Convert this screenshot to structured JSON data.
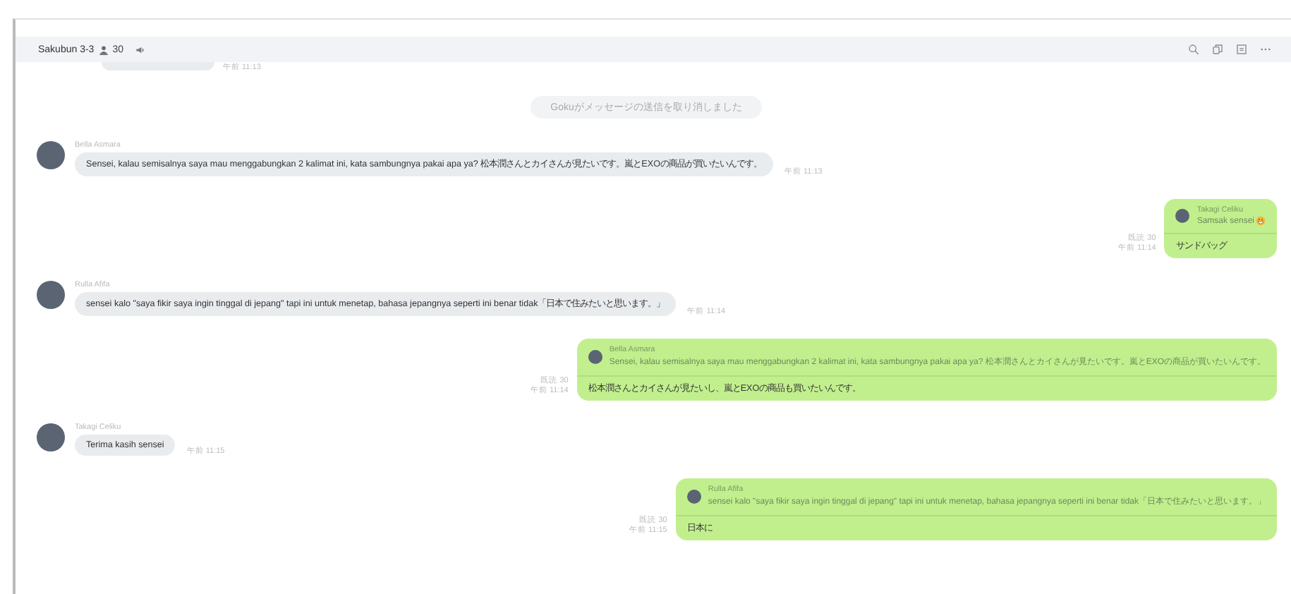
{
  "header": {
    "title": "Sakubun 3-3",
    "member_count": "30"
  },
  "messages": [
    {
      "kind": "cut",
      "time": "午前 11:13"
    },
    {
      "kind": "system",
      "text": "Gokuがメッセージの送信を取り消しました"
    },
    {
      "kind": "incoming",
      "sender": "Bella Asmara",
      "text": "Sensei, kalau semisalnya saya mau menggabungkan 2 kalimat ini, kata sambungnya pakai apa ya? 松本潤さんとカイさんが見たいです。嵐とEXOの商品が買いたいんです。",
      "time": "午前 11:13"
    },
    {
      "kind": "outgoing",
      "read": "既読 30",
      "time": "午前 11:14",
      "quote": {
        "sender": "Takagi Celiku",
        "text": "Samsak sensei",
        "emoji": true
      },
      "text": "サンドバッグ"
    },
    {
      "kind": "incoming",
      "sender": "Rulla Afifa",
      "text": "sensei kalo \"saya fikir saya ingin tinggal di jepang\" tapi ini untuk menetap, bahasa jepangnya seperti ini benar tidak「日本で住みたいと思います。」",
      "time": "午前 11:14"
    },
    {
      "kind": "outgoing",
      "read": "既読 30",
      "time": "午前 11:14",
      "quote": {
        "sender": "Bella Asmara",
        "text": "Sensei, kalau semisalnya saya mau menggabungkan 2 kalimat ini, kata sambungnya pakai apa ya? 松本潤さんとカイさんが見たいです。嵐とEXOの商品が買いたいんです。",
        "emoji": false
      },
      "text": "松本潤さんとカイさんが見たいし、嵐とEXOの商品も買いたいんです。"
    },
    {
      "kind": "incoming",
      "sender": "Takagi Celiku",
      "text": "Terima kasih sensei",
      "time": "午前 11:15"
    },
    {
      "kind": "outgoing",
      "read": "既読 30",
      "time": "午前 11:15",
      "quote": {
        "sender": "Rulla Afifa",
        "text": "sensei kalo \"saya fikir saya ingin tinggal di jepang\" tapi ini untuk menetap, bahasa jepangnya seperti ini benar tidak「日本で住みたいと思います。」",
        "emoji": false
      },
      "text": "日本に"
    }
  ]
}
